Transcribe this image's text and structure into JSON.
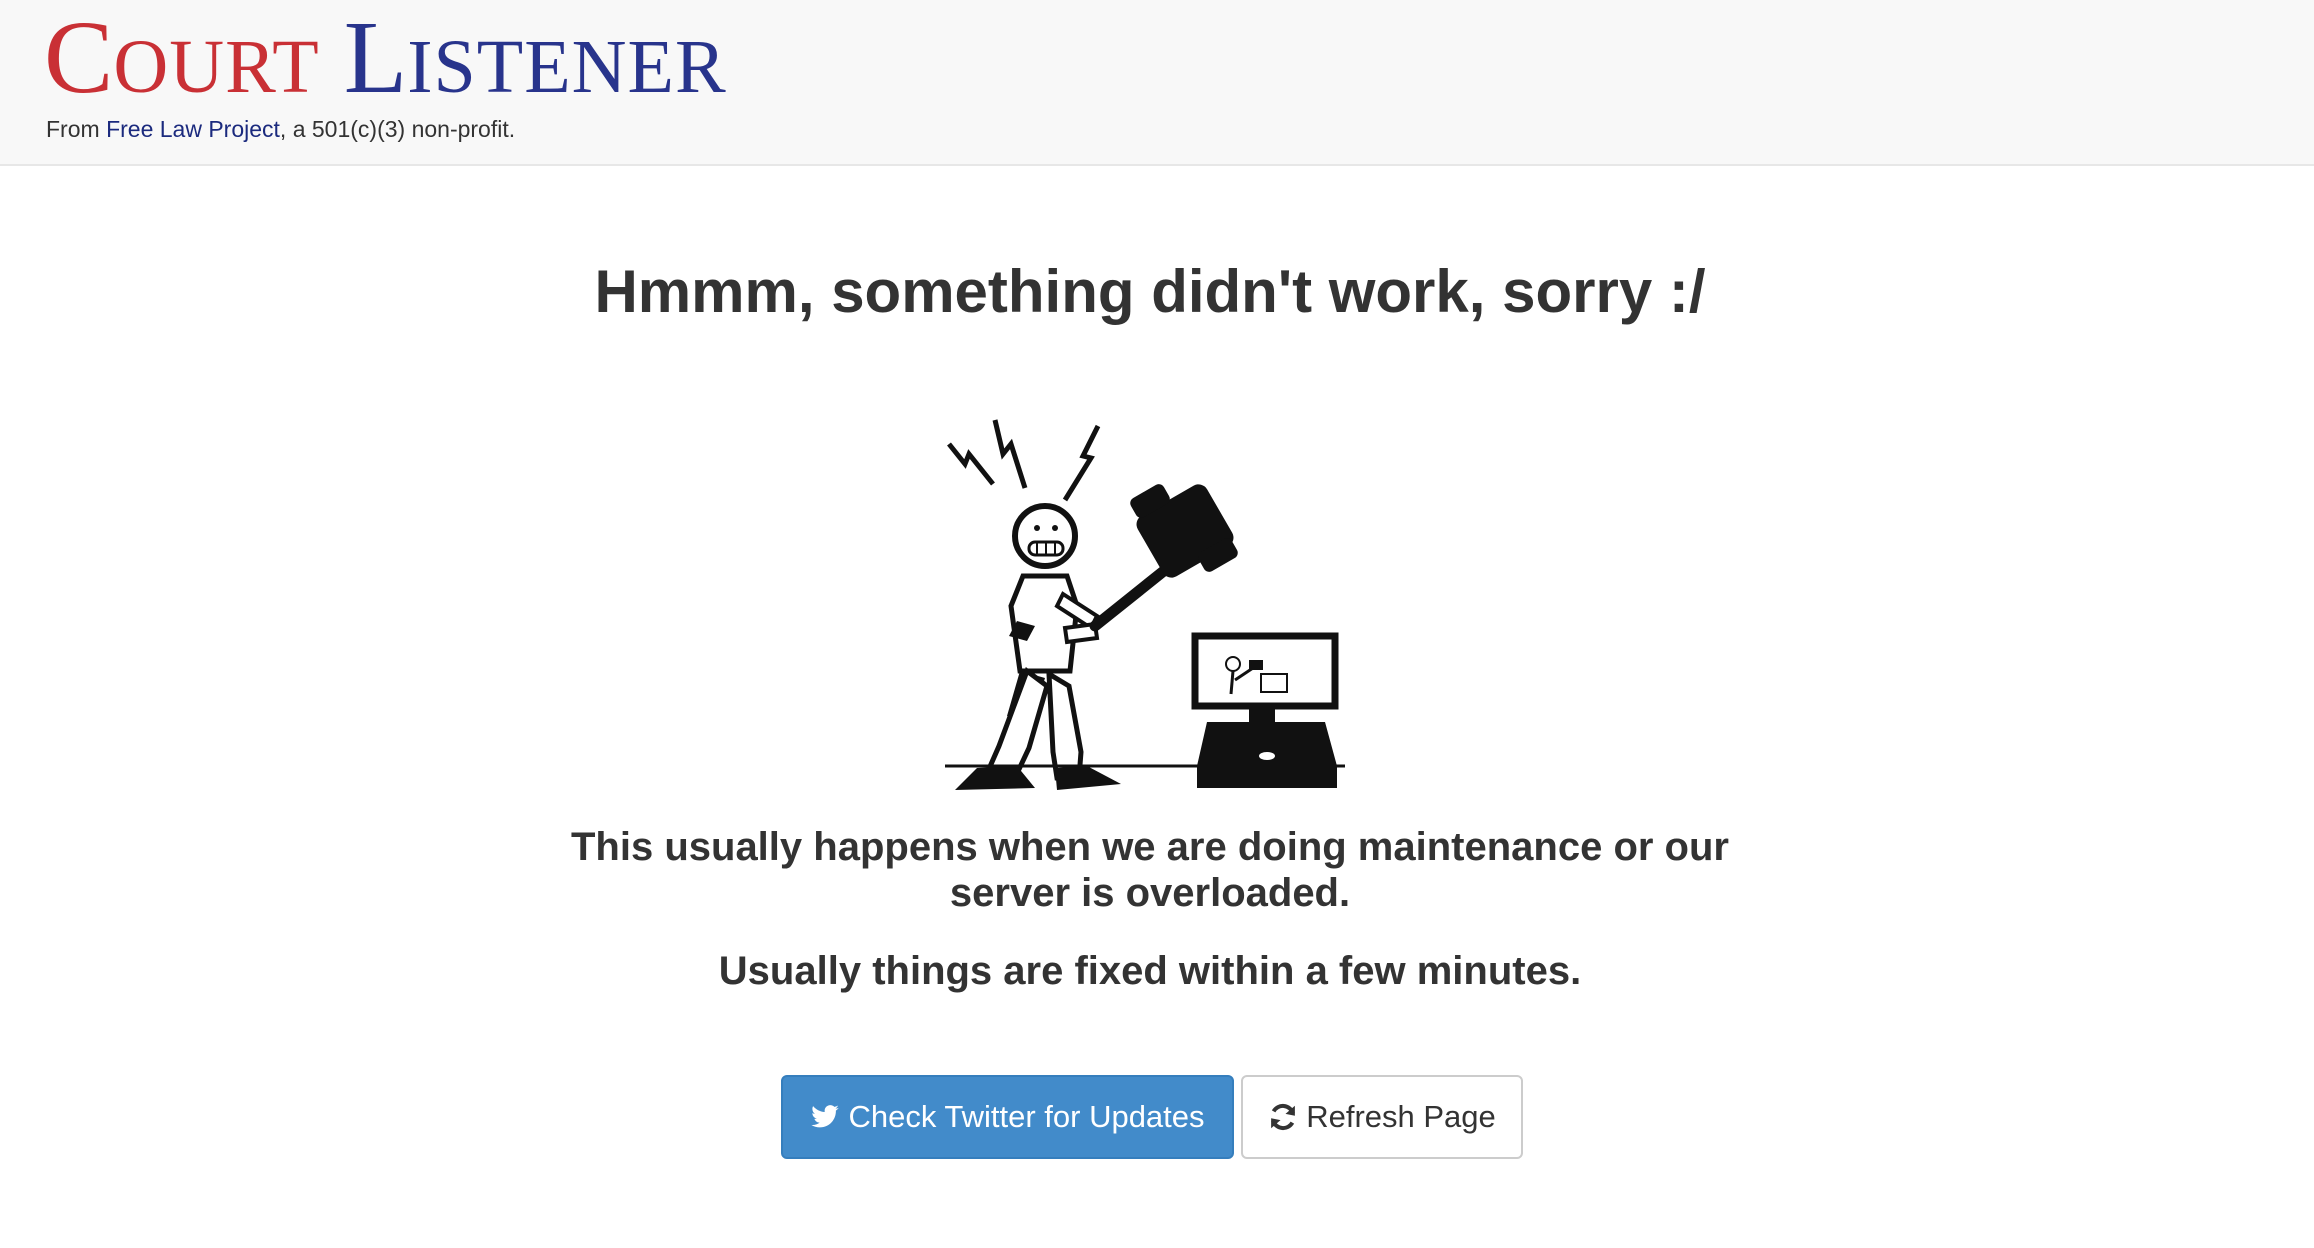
{
  "header": {
    "logo": {
      "word1_first": "C",
      "word1_rest": "OURT",
      "word2_first": "L",
      "word2_rest": "ISTENER"
    },
    "tagline": {
      "prefix": "From ",
      "link": "Free Law Project",
      "suffix": ", a 501(c)(3) non-profit."
    }
  },
  "main": {
    "title": "Hmmm, something didn't work, sorry :/",
    "message_1": "This usually happens when we are doing maintenance or our server is overloaded.",
    "message_2": "Usually things are fixed within a few minutes.",
    "buttons": {
      "twitter": {
        "label": "Check Twitter for Updates",
        "icon": "twitter-icon"
      },
      "refresh": {
        "label": "Refresh Page",
        "icon": "refresh-icon"
      }
    }
  },
  "colors": {
    "logo_red": "#c93035",
    "logo_blue": "#28348c",
    "link_blue": "#1b2a7e",
    "primary_button": "#428bca",
    "text": "#333333",
    "header_bg": "#f8f8f8"
  }
}
